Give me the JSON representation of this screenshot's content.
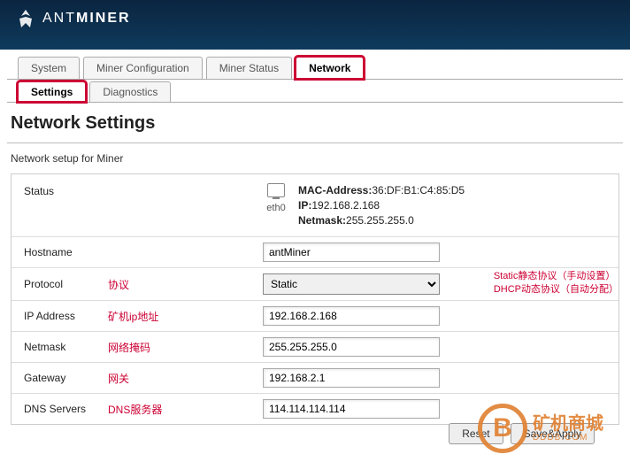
{
  "logo": {
    "part1": "ANT",
    "part2": "MINER"
  },
  "tabs_primary": [
    {
      "label": "System",
      "active": false
    },
    {
      "label": "Miner Configuration",
      "active": false
    },
    {
      "label": "Miner Status",
      "active": false
    },
    {
      "label": "Network",
      "active": true
    }
  ],
  "tabs_secondary": [
    {
      "label": "Settings",
      "active": true
    },
    {
      "label": "Diagnostics",
      "active": false
    }
  ],
  "page_title": "Network Settings",
  "subtitle": "Network setup for Miner",
  "status": {
    "label": "Status",
    "iface": "eth0",
    "mac_lbl": "MAC-Address:",
    "mac": "36:DF:B1:C4:85:D5",
    "ip_lbl": "IP:",
    "ip": "192.168.2.168",
    "nm_lbl": "Netmask:",
    "nm": "255.255.255.0"
  },
  "fields": {
    "hostname": {
      "label": "Hostname",
      "ann": "",
      "value": "antMiner"
    },
    "protocol": {
      "label": "Protocol",
      "ann": "协议",
      "value": "Static",
      "side1": "Static静态协议（手动设置）",
      "side2": "DHCP动态协议（自动分配）"
    },
    "ip": {
      "label": "IP Address",
      "ann": "矿机ip地址",
      "value": "192.168.2.168"
    },
    "netmask": {
      "label": "Netmask",
      "ann": "网络掩码",
      "value": "255.255.255.0"
    },
    "gateway": {
      "label": "Gateway",
      "ann": "网关",
      "value": "192.168.2.1"
    },
    "dns": {
      "label": "DNS Servers",
      "ann": "DNS服务器",
      "value": "114.114.114.114"
    }
  },
  "buttons": {
    "reset": "Reset",
    "save": "Save&Apply"
  },
  "watermark": {
    "main": "矿机商城",
    "sub": "DDDB.COM"
  }
}
